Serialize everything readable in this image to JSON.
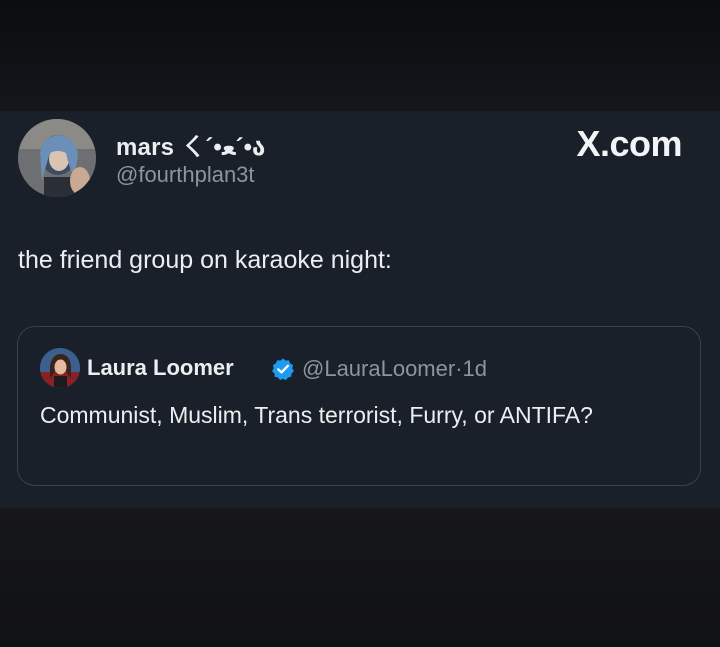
{
  "site": {
    "brand": "X.com"
  },
  "tweet": {
    "author": {
      "display_name": "mars ㄑ´•ﻌ´•ა",
      "handle": "@fourthplan3t"
    },
    "text": "the friend group on karaoke night:"
  },
  "quoted_tweet": {
    "author": {
      "display_name": "Laura Loomer",
      "handle": "@LauraLoomer",
      "verified": true
    },
    "separator": "·",
    "age": "1d",
    "text": "Communist, Muslim, Trans terrorist, Furry, or ANTIFA?"
  },
  "colors": {
    "card_background": "#1a2029",
    "primary_text": "#eceef1",
    "secondary_text": "#8c949e",
    "verified_badge": "#1d9bf0"
  },
  "icons": {
    "verified": "verified-badge-icon"
  }
}
